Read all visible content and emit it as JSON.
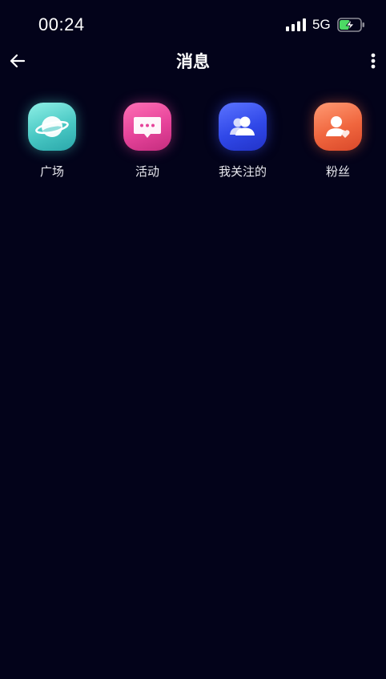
{
  "status_bar": {
    "time": "00:24",
    "network": "5G",
    "icons": [
      "signal-icon",
      "battery-charging-icon"
    ]
  },
  "header": {
    "title": "消息",
    "back_icon": "arrow-left-icon",
    "more_icon": "more-vertical-icon"
  },
  "categories": [
    {
      "label": "广场",
      "icon": "planet-icon",
      "color": "#49c8c4"
    },
    {
      "label": "活动",
      "icon": "chat-bubble-icon",
      "color": "#e6439a"
    },
    {
      "label": "我关注的",
      "icon": "users-icon",
      "color": "#3048e8"
    },
    {
      "label": "粉丝",
      "icon": "user-heart-icon",
      "color": "#f0663e"
    }
  ],
  "colors": {
    "background": "#03031a",
    "text": "#ffffff"
  }
}
